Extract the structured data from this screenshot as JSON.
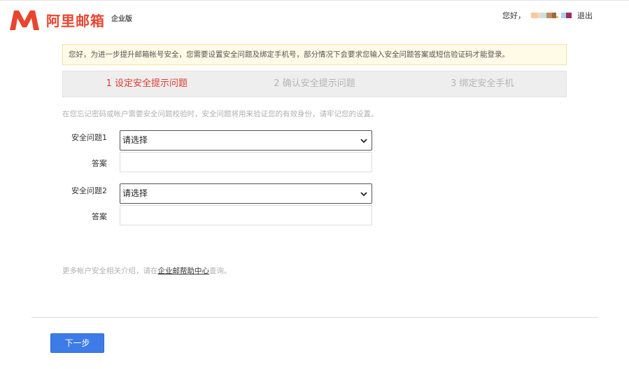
{
  "header": {
    "logo_text": "阿里邮箱",
    "edition": "企业版",
    "greeting": "您好，",
    "logout": "退出",
    "brand_color": "#e8452f",
    "name_mask_colors": [
      "#f6c9a0",
      "#f3d6b7",
      "#bfe3ee",
      "#c98a58",
      "#9a6a44",
      "#f0c15a",
      "#a9d3ee",
      "#9b2f63"
    ]
  },
  "notice": {
    "text": "您好，为进一步提升邮箱帐号安全，您需要设置安全问题及绑定手机号，部分情况下会要求您输入安全问题答案或短信验证码才能登录。"
  },
  "steps": [
    {
      "label": "1 设定安全提示问题",
      "active": true
    },
    {
      "label": "2 确认安全提示问题",
      "active": false
    },
    {
      "label": "3 绑定安全手机",
      "active": false
    }
  ],
  "description": "在您忘记密码或帐户需要安全问题校验时，安全问题将用来验证您的有效身份，请牢记您的设置。",
  "form": {
    "question1_label": "安全问题1",
    "question1_value": "请选择",
    "answer1_label": "答案",
    "answer1_value": "",
    "question2_label": "安全问题2",
    "question2_value": "请选择",
    "answer2_label": "答案",
    "answer2_value": ""
  },
  "help": {
    "prefix": "更多帐户安全相关介绍，请在",
    "link": "企业邮帮助中心",
    "suffix": "查询。"
  },
  "next_button": "下一步"
}
